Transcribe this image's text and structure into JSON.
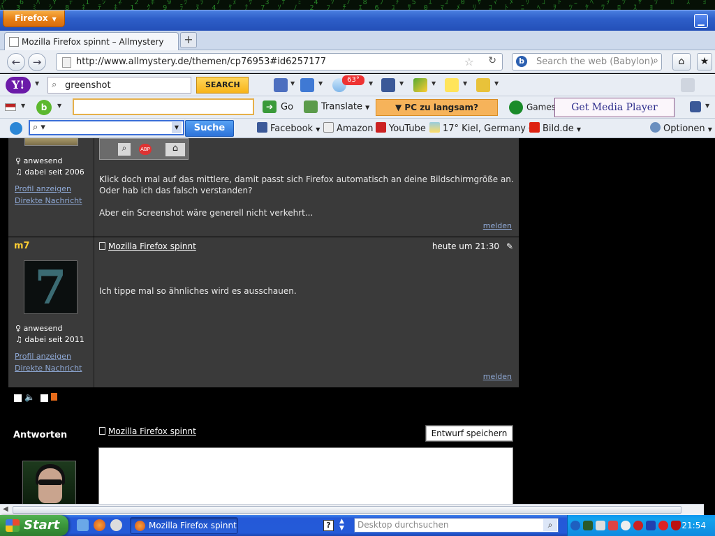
{
  "browser": {
    "menu_button": "Firefox",
    "tab_title": "Mozilla Firefox spinnt – Allmystery",
    "new_tab": "+",
    "url": "http://www.allmystery.de/themen/cp76953#id6257177",
    "search_placeholder": "Search the web (Babylon)"
  },
  "yahoo_toolbar": {
    "logo": "Y!",
    "search_value": "greenshot",
    "search_button": "SEARCH",
    "weather_badge": "63°"
  },
  "babylon_toolbar": {
    "go": "Go",
    "translate": "Translate",
    "pc_slow": "▼ PC zu langsam?",
    "games": "Games",
    "media_player": "Get Media Player Plugin"
  },
  "third_toolbar": {
    "search_button": "Suche",
    "links": [
      "Facebook",
      "Amazon",
      "YouTube",
      "17° Kiel, Germany",
      "Bild.de"
    ],
    "options": "Optionen"
  },
  "post1": {
    "status": "anwesend",
    "since": "dabei seit 2006",
    "profile_link": "Profil anzeigen",
    "message_link": "Direkte Nachricht",
    "text_line1": "Klick doch mal auf das mittlere, damit passt sich Firefox automatisch an deine Bildschirmgröße an.",
    "text_line2": "Oder hab ich das falsch verstanden?",
    "text_line3": "Aber ein Screenshot wäre generell nicht verkehrt...",
    "report": "melden"
  },
  "post2": {
    "username": "m7",
    "avatar_glyph": "7",
    "title": "Mozilla Firefox spinnt",
    "time": "heute um 21:30",
    "text": "Ich tippe mal so ähnliches wird es ausschauen.",
    "status": "anwesend",
    "since": "dabei seit 2011",
    "profile_link": "Profil anzeigen",
    "message_link": "Direkte Nachricht",
    "report": "melden"
  },
  "reply": {
    "heading": "Antworten",
    "title": "Mozilla Firefox spinnt",
    "save_draft": "Entwurf speichern"
  },
  "taskbar": {
    "start": "Start",
    "task_item": "Mozilla Firefox spinnt ...",
    "desktop_search_placeholder": "Desktop durchsuchen",
    "clock": "21:54"
  },
  "colors": {
    "post_bg": "#3a3a3a",
    "username": "#ffcf33",
    "link": "#8fa9d6"
  }
}
